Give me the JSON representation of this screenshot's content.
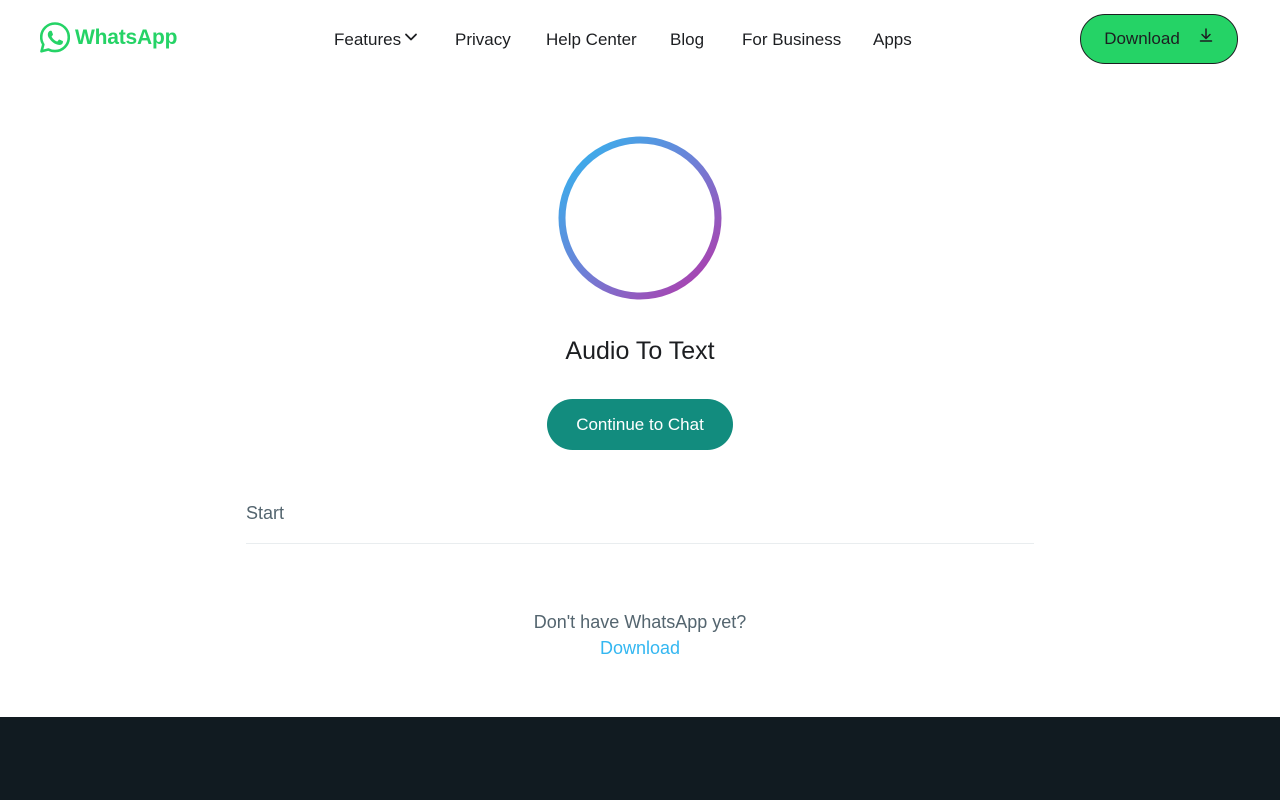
{
  "header": {
    "logo_text": "WhatsApp",
    "nav": [
      {
        "label": "Features",
        "has_dropdown": true
      },
      {
        "label": "Privacy"
      },
      {
        "label": "Help Center"
      },
      {
        "label": "Blog"
      },
      {
        "label": "For Business"
      },
      {
        "label": "Apps"
      }
    ],
    "download_label": "Download"
  },
  "main": {
    "icon": "audio-waveform-icon",
    "title": "Audio To Text",
    "continue_label": "Continue to Chat",
    "start_label": "Start",
    "no_app_text": "Don't have WhatsApp yet?",
    "no_app_link": "Download"
  },
  "colors": {
    "brand_green": "#25d366",
    "teal": "#128c7e",
    "link_blue": "#34b7f1",
    "footer_bg": "#111b21",
    "text_dark": "#1c1e21",
    "text_muted": "#54656f"
  }
}
